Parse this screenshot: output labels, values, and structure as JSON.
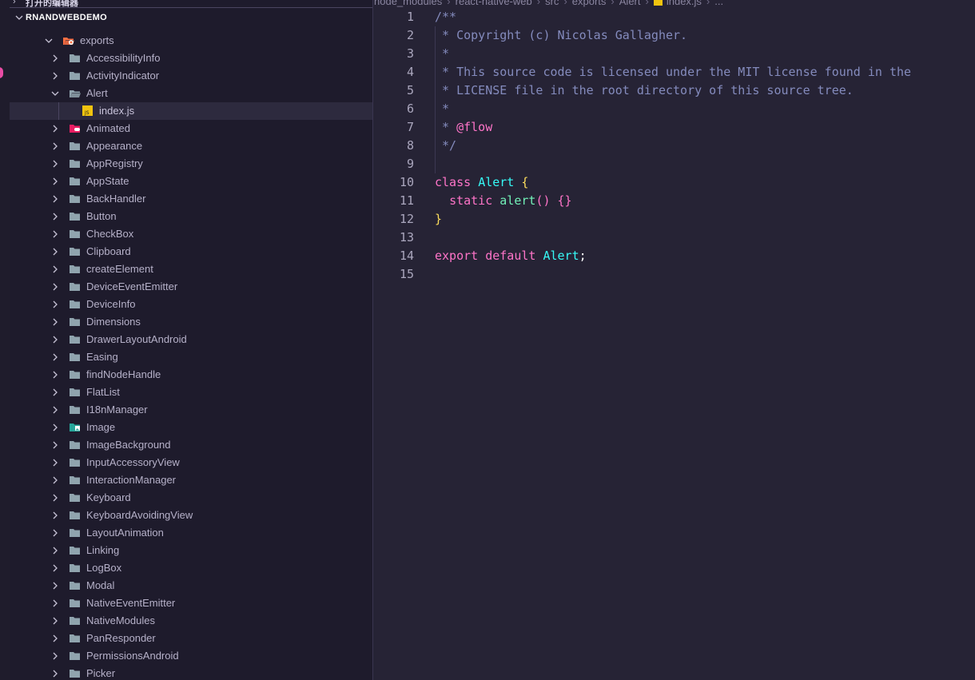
{
  "sidebar": {
    "open_editors_title": "打开的编辑器",
    "section_title": "RNANDWEBDEMO",
    "items": [
      {
        "label": "exports",
        "type": "folder-open-special",
        "depth": 2,
        "expanded": true
      },
      {
        "label": "AccessibilityInfo",
        "type": "folder",
        "depth": 3
      },
      {
        "label": "ActivityIndicator",
        "type": "folder",
        "depth": 3
      },
      {
        "label": "Alert",
        "type": "folder-open",
        "depth": 3,
        "expanded": true
      },
      {
        "label": "index.js",
        "type": "js-file",
        "depth": 4,
        "selected": true
      },
      {
        "label": "Animated",
        "type": "folder-animation",
        "depth": 3
      },
      {
        "label": "Appearance",
        "type": "folder",
        "depth": 3
      },
      {
        "label": "AppRegistry",
        "type": "folder",
        "depth": 3
      },
      {
        "label": "AppState",
        "type": "folder",
        "depth": 3
      },
      {
        "label": "BackHandler",
        "type": "folder",
        "depth": 3
      },
      {
        "label": "Button",
        "type": "folder",
        "depth": 3
      },
      {
        "label": "CheckBox",
        "type": "folder",
        "depth": 3
      },
      {
        "label": "Clipboard",
        "type": "folder",
        "depth": 3
      },
      {
        "label": "createElement",
        "type": "folder",
        "depth": 3
      },
      {
        "label": "DeviceEventEmitter",
        "type": "folder",
        "depth": 3
      },
      {
        "label": "DeviceInfo",
        "type": "folder",
        "depth": 3
      },
      {
        "label": "Dimensions",
        "type": "folder",
        "depth": 3
      },
      {
        "label": "DrawerLayoutAndroid",
        "type": "folder",
        "depth": 3
      },
      {
        "label": "Easing",
        "type": "folder",
        "depth": 3
      },
      {
        "label": "findNodeHandle",
        "type": "folder",
        "depth": 3
      },
      {
        "label": "FlatList",
        "type": "folder",
        "depth": 3
      },
      {
        "label": "I18nManager",
        "type": "folder",
        "depth": 3
      },
      {
        "label": "Image",
        "type": "folder-images",
        "depth": 3
      },
      {
        "label": "ImageBackground",
        "type": "folder",
        "depth": 3
      },
      {
        "label": "InputAccessoryView",
        "type": "folder",
        "depth": 3
      },
      {
        "label": "InteractionManager",
        "type": "folder",
        "depth": 3
      },
      {
        "label": "Keyboard",
        "type": "folder",
        "depth": 3
      },
      {
        "label": "KeyboardAvoidingView",
        "type": "folder",
        "depth": 3
      },
      {
        "label": "LayoutAnimation",
        "type": "folder",
        "depth": 3
      },
      {
        "label": "Linking",
        "type": "folder",
        "depth": 3
      },
      {
        "label": "LogBox",
        "type": "folder",
        "depth": 3
      },
      {
        "label": "Modal",
        "type": "folder",
        "depth": 3
      },
      {
        "label": "NativeEventEmitter",
        "type": "folder",
        "depth": 3
      },
      {
        "label": "NativeModules",
        "type": "folder",
        "depth": 3
      },
      {
        "label": "PanResponder",
        "type": "folder",
        "depth": 3
      },
      {
        "label": "PermissionsAndroid",
        "type": "folder",
        "depth": 3
      },
      {
        "label": "Picker",
        "type": "folder",
        "depth": 3
      }
    ]
  },
  "breadcrumb": [
    "node_modules",
    "react-native-web",
    "src",
    "exports",
    "Alert",
    "index.js",
    "..."
  ],
  "editor": {
    "lines": [
      {
        "n": "1",
        "tokens": [
          [
            "c-comment",
            "/**"
          ]
        ]
      },
      {
        "n": "2",
        "tokens": [
          [
            "c-comment",
            " * Copyright (c) Nicolas Gallagher."
          ]
        ]
      },
      {
        "n": "3",
        "tokens": [
          [
            "c-comment",
            " *"
          ]
        ]
      },
      {
        "n": "4",
        "tokens": [
          [
            "c-comment",
            " * This source code is licensed under the MIT license found in the"
          ]
        ]
      },
      {
        "n": "5",
        "tokens": [
          [
            "c-comment",
            " * LICENSE file in the root directory of this source tree."
          ]
        ]
      },
      {
        "n": "6",
        "tokens": [
          [
            "c-comment",
            " *"
          ]
        ]
      },
      {
        "n": "7",
        "tokens": [
          [
            "c-comment",
            " * "
          ],
          [
            "c-kw",
            "@flow"
          ]
        ]
      },
      {
        "n": "8",
        "tokens": [
          [
            "c-comment",
            " */"
          ]
        ]
      },
      {
        "n": "9",
        "tokens": []
      },
      {
        "n": "10",
        "tokens": [
          [
            "c-kw",
            "class"
          ],
          [
            "c-plain",
            " "
          ],
          [
            "c-cls",
            "Alert"
          ],
          [
            "c-plain",
            " "
          ],
          [
            "c-br",
            "{"
          ]
        ]
      },
      {
        "n": "11",
        "tokens": [
          [
            "c-plain",
            "  "
          ],
          [
            "c-kw",
            "static"
          ],
          [
            "c-plain",
            " "
          ],
          [
            "c-fn",
            "alert"
          ],
          [
            "c-br2",
            "()"
          ],
          [
            "c-plain",
            " "
          ],
          [
            "c-br2",
            "{}"
          ]
        ]
      },
      {
        "n": "12",
        "tokens": [
          [
            "c-br",
            "}"
          ]
        ]
      },
      {
        "n": "13",
        "tokens": []
      },
      {
        "n": "14",
        "tokens": [
          [
            "c-kw",
            "export"
          ],
          [
            "c-plain",
            " "
          ],
          [
            "c-kw",
            "default"
          ],
          [
            "c-plain",
            " "
          ],
          [
            "c-cls",
            "Alert"
          ],
          [
            "c-plain",
            ";"
          ]
        ]
      },
      {
        "n": "15",
        "tokens": []
      }
    ]
  },
  "colors": {
    "background": "#262335",
    "sidebar": "#1e1b2c",
    "folder": "#90a4ae",
    "js_icon": "#f1c40f",
    "exports_folder": "#ff7043",
    "animated_folder": "#e91e63",
    "images_folder": "#26a69a"
  }
}
